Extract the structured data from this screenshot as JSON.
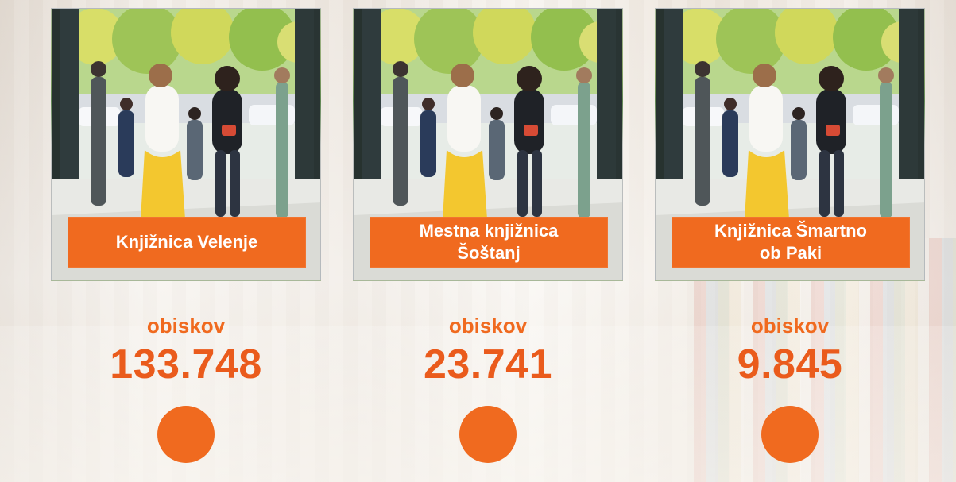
{
  "cards": [
    {
      "library_name": "Knjižnica Velenje",
      "stat_label": "obiskov",
      "stat_value": "133.748"
    },
    {
      "library_name": "Mestna knjižnica\nŠoštanj",
      "stat_label": "obiskov",
      "stat_value": "23.741"
    },
    {
      "library_name": "Knjižnica Šmartno\nob Paki",
      "stat_label": "obiskov",
      "stat_value": "9.845"
    }
  ],
  "colors": {
    "accent": "#f06a1f",
    "accent_dark": "#ea5b1c",
    "label_text": "#ffffff"
  },
  "icons": {
    "circle_marker": "circle-icon"
  }
}
